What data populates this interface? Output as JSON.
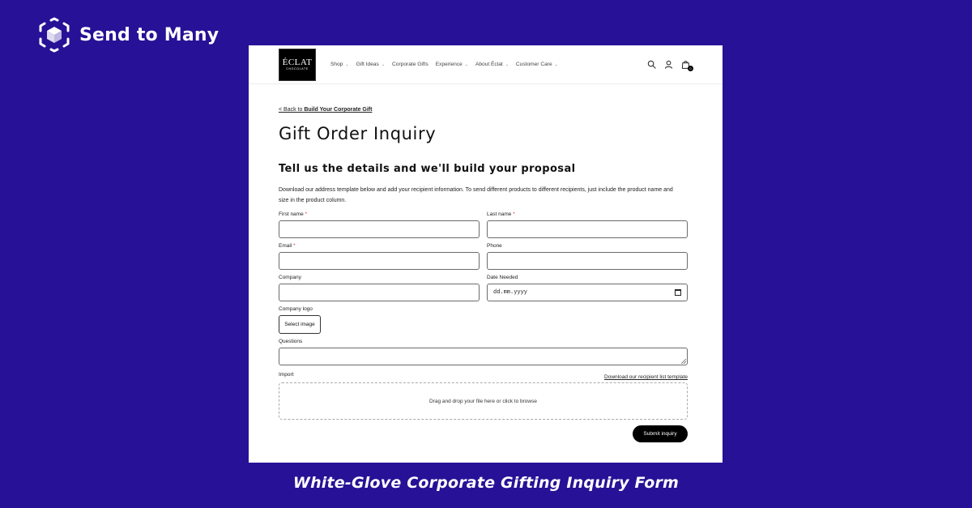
{
  "brand": {
    "name": "Send to Many",
    "logo_icon": "cube-in-brackets-icon",
    "background_color": "#271196"
  },
  "site": {
    "logo_line1": "ÉCLAT",
    "logo_line2": "CHOCOLATE",
    "nav": [
      {
        "label": "Shop",
        "dropdown": true
      },
      {
        "label": "Gift Ideas",
        "dropdown": true
      },
      {
        "label": "Corporate Gifts",
        "dropdown": false
      },
      {
        "label": "Experience",
        "dropdown": true
      },
      {
        "label": "About Éclat",
        "dropdown": true
      },
      {
        "label": "Customer Care",
        "dropdown": true
      }
    ],
    "header_icons": [
      "search-icon",
      "account-icon",
      "cart-icon"
    ],
    "cart_count": "0"
  },
  "form": {
    "back_prefix": "< Back to ",
    "back_link": "Build Your Corporate Gift",
    "title": "Gift Order Inquiry",
    "subtitle": "Tell us the details and we'll build your proposal",
    "intro": "Download our address template below and add your recipient information. To send different products to different recipients, just include the product name and size in the product column.",
    "first_name_label": "First name",
    "last_name_label": "Last name",
    "email_label": "Email",
    "phone_label": "Phone",
    "company_label": "Company",
    "date_label": "Date Needed",
    "date_placeholder": "dd.mm.yyyy",
    "required_mark": "*",
    "logo_label": "Company logo",
    "select_image": "Select image",
    "questions_label": "Questions",
    "import_label": "Import",
    "download_link": "Download our recipient list template",
    "dropzone_text": "Drag and drop your file here or click to browse",
    "submit": "Submit inquiry"
  },
  "caption": "White-Glove Corporate Gifting Inquiry Form"
}
